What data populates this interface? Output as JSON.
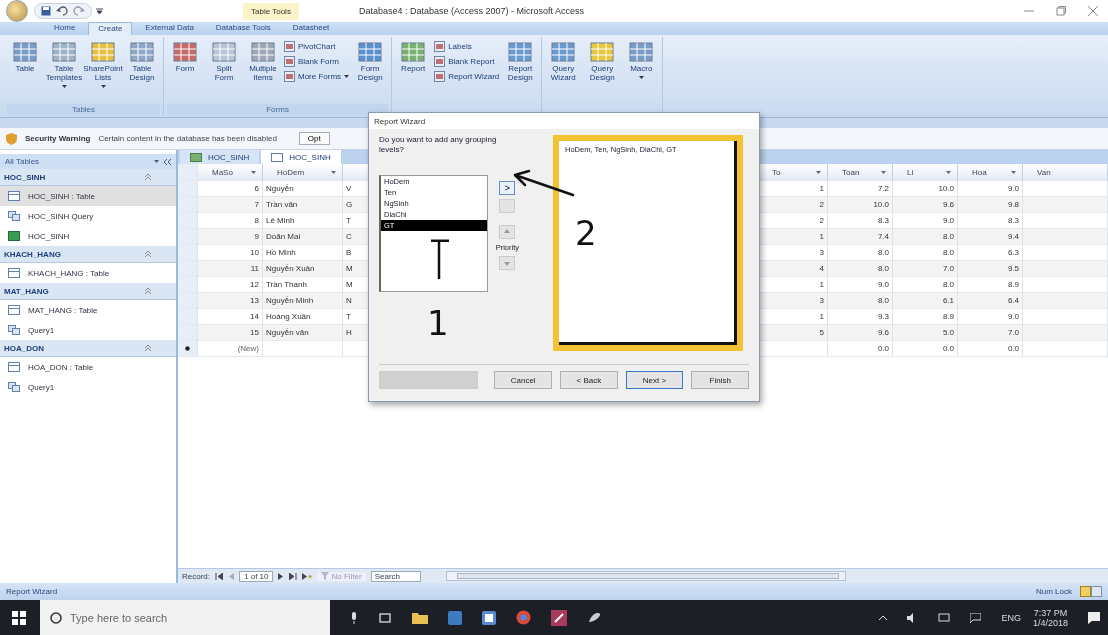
{
  "window": {
    "title": "Database4 : Database (Access 2007) - Microsoft Access",
    "contextual_tab": "Table Tools"
  },
  "ribbon_tabs": [
    {
      "label": "Home",
      "selected": false
    },
    {
      "label": "Create",
      "selected": true
    },
    {
      "label": "External Data",
      "selected": false
    },
    {
      "label": "Database Tools",
      "selected": false
    },
    {
      "label": "Datasheet",
      "selected": false
    }
  ],
  "ribbon_groups": [
    {
      "label": "Tables",
      "items": [
        {
          "kind": "large",
          "label": "Table"
        },
        {
          "kind": "large",
          "label": "Table Templates",
          "dropdown": true
        },
        {
          "kind": "large",
          "label": "SharePoint Lists",
          "dropdown": true
        },
        {
          "kind": "large",
          "label": "Table Design"
        }
      ]
    },
    {
      "label": "Forms",
      "items": [
        {
          "kind": "large",
          "label": "Form"
        },
        {
          "kind": "large",
          "label": "Split Form"
        },
        {
          "kind": "large",
          "label": "Multiple Items"
        },
        {
          "kind": "stack",
          "items": [
            {
              "label": "PivotChart"
            },
            {
              "label": "Blank Form"
            },
            {
              "label": "More Forms",
              "dropdown": true
            }
          ]
        },
        {
          "kind": "large",
          "label": "Form Design"
        }
      ]
    },
    {
      "items": [
        {
          "kind": "large",
          "label": "Report"
        },
        {
          "kind": "stack",
          "items": [
            {
              "label": "Labels"
            },
            {
              "label": "Blank Report"
            },
            {
              "label": "Report Wizard"
            }
          ]
        },
        {
          "kind": "large",
          "label": "Report Design"
        }
      ]
    },
    {
      "items": [
        {
          "kind": "large",
          "label": "Query Wizard"
        },
        {
          "kind": "large",
          "label": "Query Design"
        },
        {
          "kind": "large",
          "label": "Macro",
          "dropdown": true
        }
      ]
    }
  ],
  "security_bar": {
    "title": "Security Warning",
    "message": "Certain content in the database has been disabled",
    "button": "Opt"
  },
  "nav": {
    "title": "All Tables",
    "groups": [
      {
        "label": "HOC_SINH",
        "items": [
          {
            "kind": "table",
            "label": "HOC_SINH : Table",
            "selected": true
          },
          {
            "kind": "query",
            "label": "HOC_SINH Query",
            "selected": false
          },
          {
            "kind": "form",
            "label": "HOC_SINH",
            "selected": false
          }
        ]
      },
      {
        "label": "KHACH_HANG",
        "items": [
          {
            "kind": "table",
            "label": "KHACH_HANG : Table",
            "selected": false
          }
        ]
      },
      {
        "label": "MAT_HANG",
        "items": [
          {
            "kind": "table",
            "label": "MAT_HANG : Table",
            "selected": false
          },
          {
            "kind": "query",
            "label": "Query1",
            "selected": false
          }
        ]
      },
      {
        "label": "HOA_DON",
        "items": [
          {
            "kind": "table",
            "label": "HOA_DON : Table",
            "selected": false
          },
          {
            "kind": "query",
            "label": "Query1",
            "selected": false
          }
        ]
      }
    ]
  },
  "doc_tabs": [
    {
      "kind": "query",
      "label": "HOC_SINH",
      "selected": false
    },
    {
      "kind": "table",
      "label": "HOC_SINH",
      "selected": true
    }
  ],
  "datasheet": {
    "left_columns": [
      "MaSo",
      "HoDem"
    ],
    "right_columns": [
      "To",
      "Toan",
      "Li",
      "Hoa",
      "Van"
    ],
    "rows": [
      {
        "new": false,
        "maso": "6",
        "hodem": "Nguyễn",
        "column_3": "V",
        "to": "1",
        "toan": "7.2",
        "li": "10.0",
        "hoa": "9.0"
      },
      {
        "new": false,
        "maso": "7",
        "hodem": "Trần văn",
        "column_3": "G",
        "to": "2",
        "toan": "10.0",
        "li": "9.6",
        "hoa": "9.8"
      },
      {
        "new": false,
        "maso": "8",
        "hodem": "Lê Minh",
        "column_3": "T",
        "to": "2",
        "toan": "8.3",
        "li": "9.0",
        "hoa": "8.3"
      },
      {
        "new": false,
        "maso": "9",
        "hodem": "Doãn Mai",
        "column_3": "C",
        "to": "1",
        "toan": "7.4",
        "li": "8.0",
        "hoa": "9.4"
      },
      {
        "new": false,
        "maso": "10",
        "hodem": "Hồ Minh",
        "column_3": "B",
        "to": "3",
        "toan": "8.0",
        "li": "8.0",
        "hoa": "6.3"
      },
      {
        "new": false,
        "maso": "11",
        "hodem": "Nguyễn Xuân",
        "column_3": "M",
        "to": "4",
        "toan": "8.0",
        "li": "7.0",
        "hoa": "9.5"
      },
      {
        "new": false,
        "maso": "12",
        "hodem": "Trần Thanh",
        "column_3": "M",
        "to": "1",
        "toan": "9.0",
        "li": "8.0",
        "hoa": "8.9"
      },
      {
        "new": false,
        "maso": "13",
        "hodem": "Nguyễn Minh",
        "column_3": "N",
        "to": "3",
        "toan": "8.0",
        "li": "6.1",
        "hoa": "6.4"
      },
      {
        "new": false,
        "maso": "14",
        "hodem": "Hoàng Xuân",
        "column_3": "T",
        "to": "1",
        "toan": "9.3",
        "li": "8.9",
        "hoa": "9.0"
      },
      {
        "new": false,
        "maso": "15",
        "hodem": "Nguyễn văn",
        "column_3": "H",
        "to": "5",
        "toan": "9.6",
        "li": "5.0",
        "hoa": "7.0"
      },
      {
        "new": true,
        "maso": "(New)",
        "toan": "0.0",
        "li": "0.0",
        "hoa": "0.0"
      }
    ]
  },
  "record_nav": {
    "label": "Record:",
    "position": "1 of 10",
    "filter": "No Filter",
    "search_placeholder": "Search"
  },
  "status_bar": {
    "text": "Report Wizard",
    "indicator": "Num Lock"
  },
  "taskbar": {
    "search_placeholder": "Type here to search",
    "language": "ENG",
    "time": "7:37 PM",
    "date": "1/4/2018"
  },
  "dialog": {
    "title": "Report Wizard",
    "question": "Do you want to add any grouping levels?",
    "fields": [
      {
        "label": "HoDem",
        "selected": false
      },
      {
        "label": "Ten",
        "selected": false
      },
      {
        "label": "NgSinh",
        "selected": false
      },
      {
        "label": "DiaChi",
        "selected": false
      },
      {
        "label": "GT",
        "selected": true
      }
    ],
    "side_buttons": [
      {
        "kind": "add",
        "label": ">",
        "disabled": false
      },
      {
        "kind": "remove",
        "disabled": true
      },
      {
        "kind": "up",
        "disabled": true
      },
      {
        "kind": "down",
        "disabled": true
      }
    ],
    "priority_label": "Priority",
    "preview_text": "HoDem, Ten, NgSinh, DiaChi, GT",
    "grouping_options_disabled": true,
    "buttons": [
      {
        "label": "Cancel",
        "default": false
      },
      {
        "label": "< Back",
        "default": false
      },
      {
        "label": "Next >",
        "default": true
      },
      {
        "label": "Finish",
        "default": false
      }
    ],
    "annotations": [
      {
        "label": "1"
      },
      {
        "label": "2"
      }
    ]
  }
}
